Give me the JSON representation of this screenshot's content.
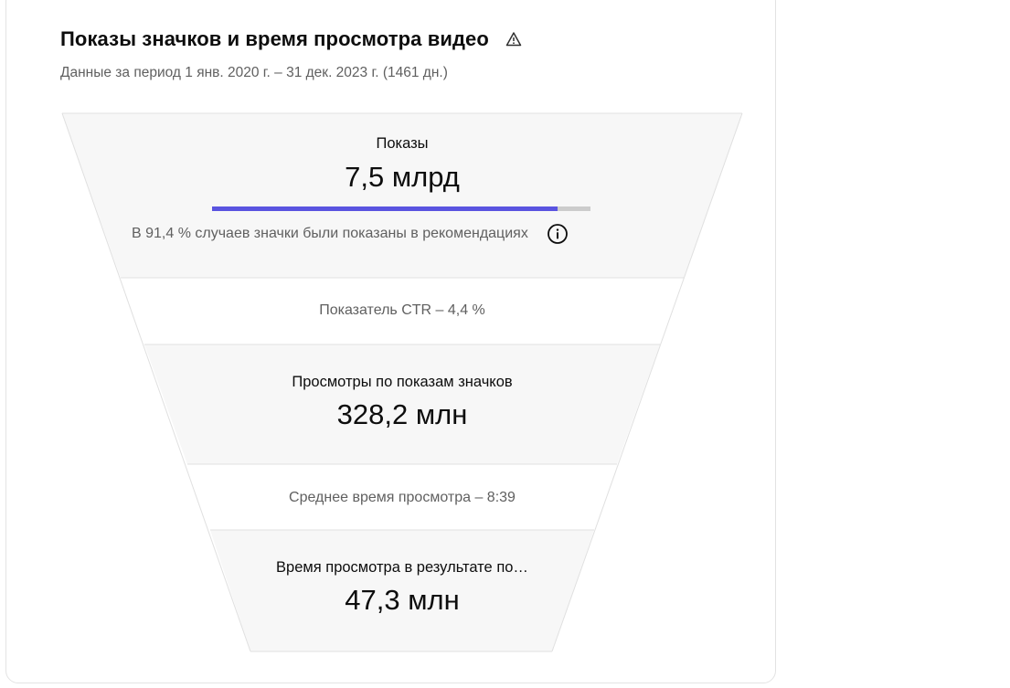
{
  "header": {
    "title": "Показы значков и время просмотра видео",
    "warning_icon": "warning-icon",
    "subtitle": "Данные за период 1 янв. 2020 г. – 31 дек. 2023 г. (1461 дн.)"
  },
  "funnel": {
    "impressions": {
      "label": "Показы",
      "value": "7,5 млрд",
      "recommendations_share": 0.914,
      "note": "В 91,4 % случаев значки были показаны в рекомендациях",
      "info_icon": "info-icon"
    },
    "ctr": {
      "text": "Показатель CTR – 4,4 %"
    },
    "views": {
      "label": "Просмотры по показам значков",
      "value": "328,2 млн"
    },
    "avg_watch": {
      "text": "Среднее время просмотра – 8:39"
    },
    "watch_time": {
      "label": "Время просмотра в результате по…",
      "value": "47,3 млн"
    }
  },
  "colors": {
    "accent": "#5a54e0",
    "band_fill": "#f7f7f7",
    "divider": "#e0e0e0"
  }
}
